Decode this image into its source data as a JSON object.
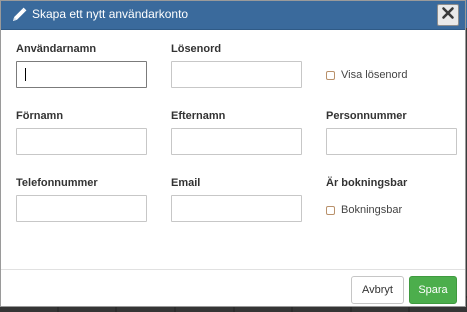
{
  "dialog": {
    "title": "Skapa ett nytt användarkonto",
    "icons": {
      "title": "pencil-icon",
      "close": "close-icon"
    }
  },
  "form": {
    "username": {
      "label": "Användarnamn",
      "value": ""
    },
    "password": {
      "label": "Lösenord",
      "value": ""
    },
    "show_password": {
      "label": "Visa lösenord",
      "checked": false
    },
    "first_name": {
      "label": "Förnamn",
      "value": ""
    },
    "last_name": {
      "label": "Efternamn",
      "value": ""
    },
    "personal_number": {
      "label": "Personnummer",
      "value": ""
    },
    "phone": {
      "label": "Telefonnummer",
      "value": ""
    },
    "email": {
      "label": "Email",
      "value": ""
    },
    "bookable": {
      "heading": "Är bokningsbar",
      "label": "Bokningsbar",
      "checked": false
    }
  },
  "footer": {
    "cancel_label": "Avbryt",
    "save_label": "Spara"
  },
  "colors": {
    "titlebar": "#3a6a9c",
    "save_button": "#4cae4c",
    "checkbox_border": "#b9916b"
  }
}
